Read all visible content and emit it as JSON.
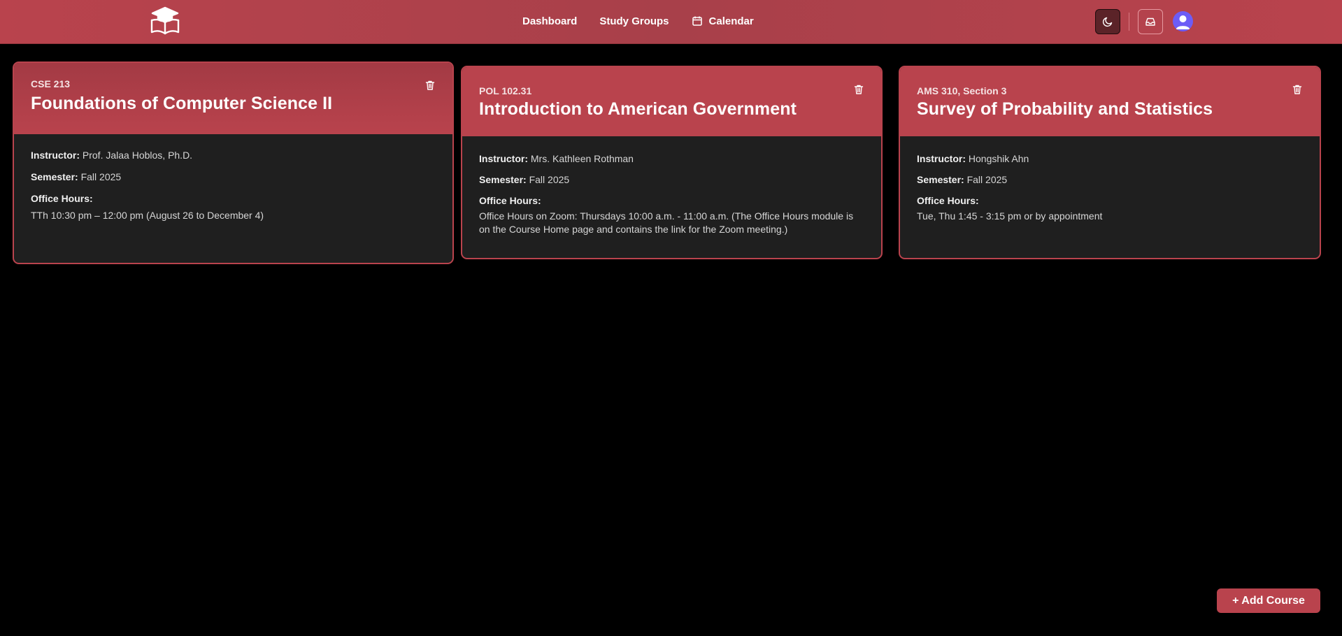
{
  "nav": {
    "links": [
      {
        "label": "Dashboard"
      },
      {
        "label": "Study Groups"
      },
      {
        "label": "Calendar"
      }
    ]
  },
  "courses": [
    {
      "code": "CSE 213",
      "title": "Foundations of Computer Science II",
      "instructor_label": "Instructor:",
      "instructor": "Prof. Jalaa Hoblos, Ph.D.",
      "semester_label": "Semester:",
      "semester": "Fall 2025",
      "office_hours_label": "Office Hours:",
      "office_hours": "TTh 10:30 pm – 12:00 pm (August 26 to December 4)"
    },
    {
      "code": "POL 102.31",
      "title": "Introduction to American Government",
      "instructor_label": "Instructor:",
      "instructor": "Mrs. Kathleen Rothman",
      "semester_label": "Semester:",
      "semester": "Fall 2025",
      "office_hours_label": "Office Hours:",
      "office_hours": "Office Hours on Zoom: Thursdays 10:00 a.m. - 11:00 a.m. (The Office Hours module is on the Course Home page and contains the link for the Zoom meeting.)"
    },
    {
      "code": "AMS 310, Section 3",
      "title": "Survey of Probability and Statistics",
      "instructor_label": "Instructor:",
      "instructor": "Hongshik Ahn",
      "semester_label": "Semester:",
      "semester": "Fall 2025",
      "office_hours_label": "Office Hours:",
      "office_hours": "Tue, Thu 1:45 - 3:15 pm or by appointment"
    }
  ],
  "add_course_label": "+ Add Course",
  "colors": {
    "brand": "#b9434d",
    "card_bg": "#1f1f1f",
    "page_bg": "#000000",
    "avatar": "#6d5cf6"
  },
  "icons": {
    "logo": "graduation-cap-book-icon",
    "calendar": "calendar-icon",
    "theme": "moon-icon",
    "inbox": "inbox-icon",
    "avatar": "user-icon",
    "delete": "trash-icon"
  }
}
